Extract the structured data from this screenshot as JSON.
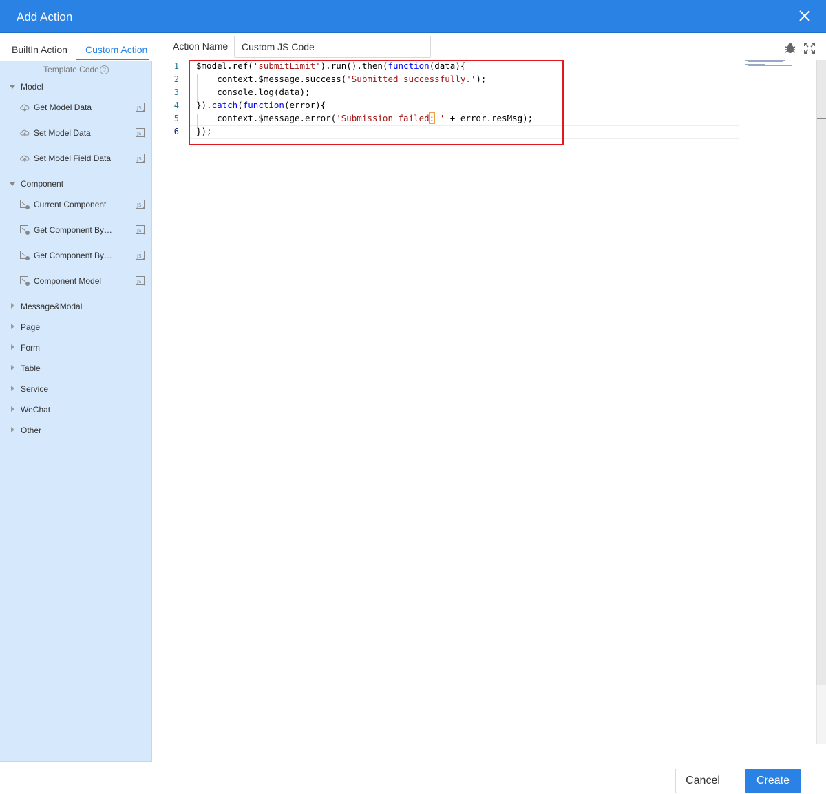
{
  "dialog": {
    "title": "Add Action"
  },
  "tabs": {
    "builtin": "BuiltIn Action",
    "custom": "Custom Action"
  },
  "template": {
    "heading": "Template Code"
  },
  "groups": {
    "model": {
      "label": "Model",
      "expanded": true,
      "items": [
        "Get Model Data",
        "Set Model Data",
        "Set Model Field Data"
      ]
    },
    "component": {
      "label": "Component",
      "expanded": true,
      "items": [
        "Current Component",
        "Get Component By…",
        "Get Component By…",
        "Component Model"
      ]
    },
    "collapsed": [
      "Message&Modal",
      "Page",
      "Form",
      "Table",
      "Service",
      "WeChat",
      "Other"
    ]
  },
  "action_name": {
    "label": "Action Name",
    "value": "Custom JS Code"
  },
  "editor": {
    "line_numbers": [
      "1",
      "2",
      "3",
      "4",
      "5",
      "6"
    ],
    "code": {
      "l1a": "$model.ref(",
      "l1b": "'submitLimit'",
      "l1c": ").run().then(",
      "l1d": "function",
      "l1e": "(data){",
      "l2a": "    context.$message.success(",
      "l2b": "'Submitted successfully.'",
      "l2c": ");",
      "l3": "    console.log(data);",
      "l4a": "}).",
      "l4b": "catch",
      "l4c": "(",
      "l4d": "function",
      "l4e": "(error){",
      "l5a": "    context.$message.error(",
      "l5b": "'Submission failed",
      "l5c": ":",
      "l5d": " '",
      "l5e": " + error.resMsg);",
      "l6": "});"
    }
  },
  "buttons": {
    "cancel": "Cancel",
    "create": "Create"
  },
  "colors": {
    "accent": "#2a82e4",
    "sidebar_bg": "#d6e8fc",
    "highlight_box": "#e0191d",
    "keyword": "#0000ff",
    "string": "#a31515"
  },
  "icons": {
    "close": "close-icon",
    "debug": "bug-icon",
    "fullscreen": "fullscreen-icon",
    "template_item": "js-snippet-icon"
  }
}
